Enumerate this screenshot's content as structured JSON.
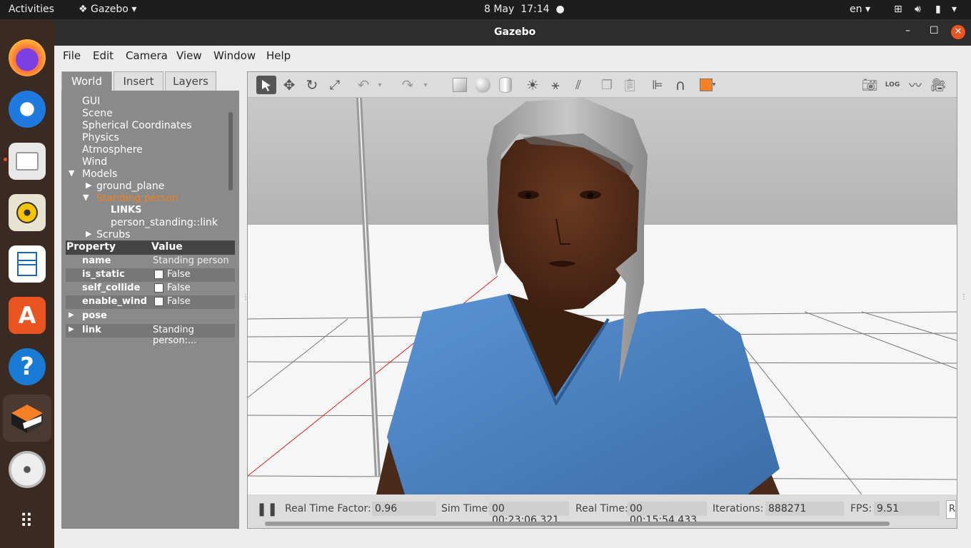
{
  "topbar": {
    "activities": "Activities",
    "app_name": "Gazebo",
    "date": "8 May",
    "time": "17:14",
    "lang": "en"
  },
  "window": {
    "title": "Gazebo"
  },
  "menu": [
    "File",
    "Edit",
    "Camera",
    "View",
    "Window",
    "Help"
  ],
  "tabs": [
    "World",
    "Insert",
    "Layers"
  ],
  "tree": [
    "GUI",
    "Scene",
    "Spherical Coordinates",
    "Physics",
    "Atmosphere",
    "Wind",
    "Models",
    "ground_plane",
    "Standing person",
    "LINKS",
    "person_standing::link",
    "Scrubs"
  ],
  "props": {
    "header": {
      "property": "Property",
      "value": "Value"
    },
    "rows": [
      {
        "k": "name",
        "v": "Standing person"
      },
      {
        "k": "is_static",
        "v": "False"
      },
      {
        "k": "self_collide",
        "v": "False"
      },
      {
        "k": "enable_wind",
        "v": "False"
      },
      {
        "k": "pose",
        "v": ""
      },
      {
        "k": "link",
        "v": "Standing person:..."
      }
    ]
  },
  "status": {
    "rtf_label": "Real Time Factor:",
    "rtf": "0.96",
    "sim_label": "Sim Time:",
    "sim": "00 00:23:06.321",
    "real_label": "Real Time:",
    "real": "00 00:15:54.433",
    "iter_label": "Iterations:",
    "iter": "888271",
    "fps_label": "FPS:",
    "fps": "9.51",
    "reset": "R"
  },
  "colors": {
    "accent": "#e95420",
    "selected_model": "#f07f1c",
    "shirt": "#4a7fc0"
  }
}
